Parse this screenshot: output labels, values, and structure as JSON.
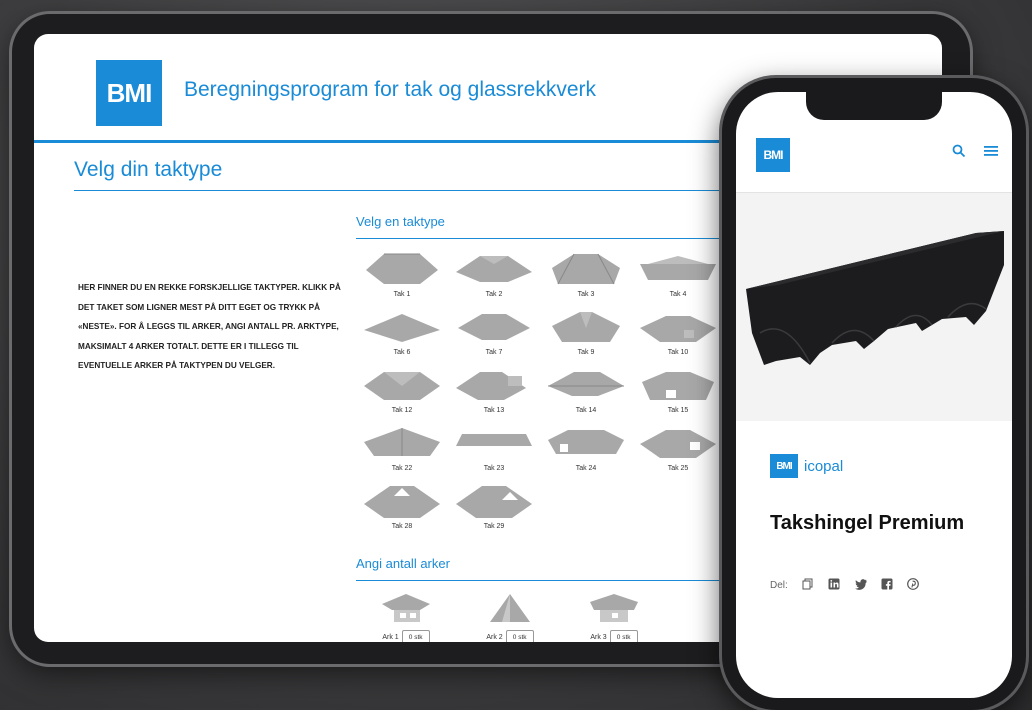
{
  "tablet": {
    "logo_text": "BMI",
    "app_title": "Beregningsprogram for tak og glassrekkverk",
    "page_title": "Velg din taktype",
    "intro_text": "HER FINNER DU EN REKKE FORSKJELLIGE TAKTYPER. KLIKK PÅ DET TAKET SOM LIGNER MEST PÅ DITT EGET OG TRYKK PÅ «NESTE». FOR Å LEGGS TIL ARKER, ANGI ANTALL PR. ARKTYPE, MAKSIMALT 4 ARKER TOTALT. DETTE ER I TILLEGG TIL EVENTUELLE ARKER PÅ TAKTYPEN DU VELGER.",
    "roof_section_label": "Velg en taktype",
    "roof_types": [
      {
        "label": "Tak 1"
      },
      {
        "label": "Tak 2"
      },
      {
        "label": "Tak 3"
      },
      {
        "label": "Tak 4"
      },
      {
        "label": "Tak 6"
      },
      {
        "label": "Tak 7"
      },
      {
        "label": "Tak 9"
      },
      {
        "label": "Tak 10"
      },
      {
        "label": "Tak 12"
      },
      {
        "label": "Tak 13"
      },
      {
        "label": "Tak 14"
      },
      {
        "label": "Tak 15"
      },
      {
        "label": "Tak 22"
      },
      {
        "label": "Tak 23"
      },
      {
        "label": "Tak 24"
      },
      {
        "label": "Tak 25"
      },
      {
        "label": "Tak 28"
      },
      {
        "label": "Tak 29"
      }
    ],
    "ark_section_label": "Angi antall arker",
    "arks": [
      {
        "label": "Ark 1",
        "value": "0 stk"
      },
      {
        "label": "Ark 2",
        "value": "0 stk"
      },
      {
        "label": "Ark 3",
        "value": "0 stk"
      }
    ]
  },
  "phone": {
    "logo_text": "BMI",
    "search_icon": "search-icon",
    "menu_icon": "hamburger-menu-icon",
    "brand_logo_text": "BMI",
    "brand_name": "icopal",
    "product_title": "Takshingel Premium",
    "share_label": "Del:",
    "share_icons": [
      "copy-icon",
      "linkedin-icon",
      "twitter-icon",
      "facebook-icon",
      "pinterest-icon"
    ]
  },
  "colors": {
    "brand_blue": "#1a8bd6",
    "roof_gray": "#a8a8a8",
    "shingle_black": "#1c1c1e"
  }
}
